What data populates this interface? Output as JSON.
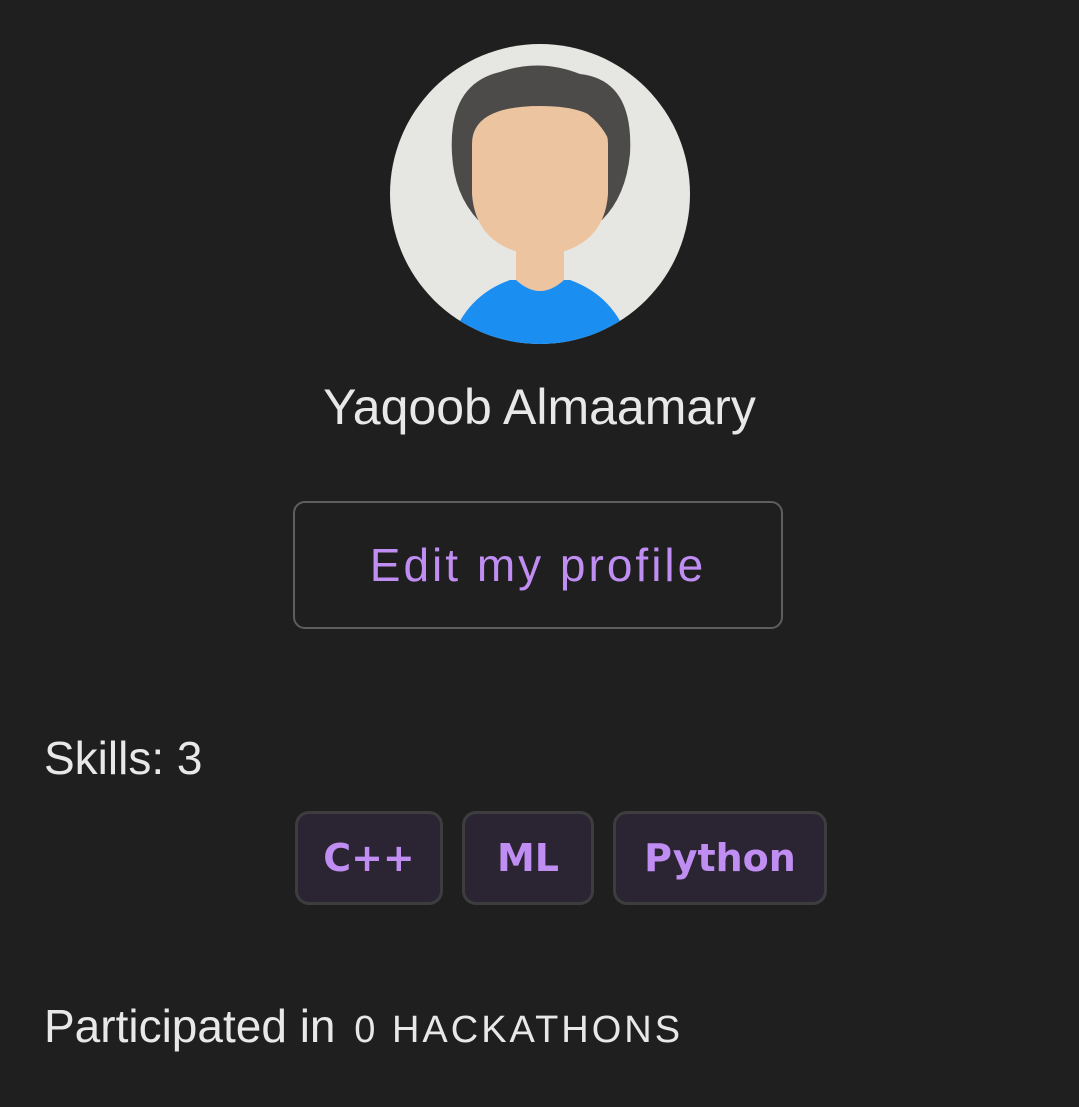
{
  "profile": {
    "name": "Yaqoob Almaamary",
    "avatar_icon": "default-user-avatar"
  },
  "actions": {
    "edit_label": "Edit my profile"
  },
  "skills": {
    "heading": "Skills: 3",
    "items": [
      "C++",
      "ML",
      "Python"
    ]
  },
  "hackathons": {
    "prefix": "Participated in",
    "count_text": "0 HACKATHONS"
  },
  "colors": {
    "background": "#1f1f1f",
    "accent": "#c08ef2",
    "chip_background": "#2b2533",
    "avatar_background": "#e6e6e2",
    "avatar_hair": "#4d4b4a",
    "avatar_skin": "#ecc4a0",
    "avatar_shirt": "#1b8ef2"
  }
}
